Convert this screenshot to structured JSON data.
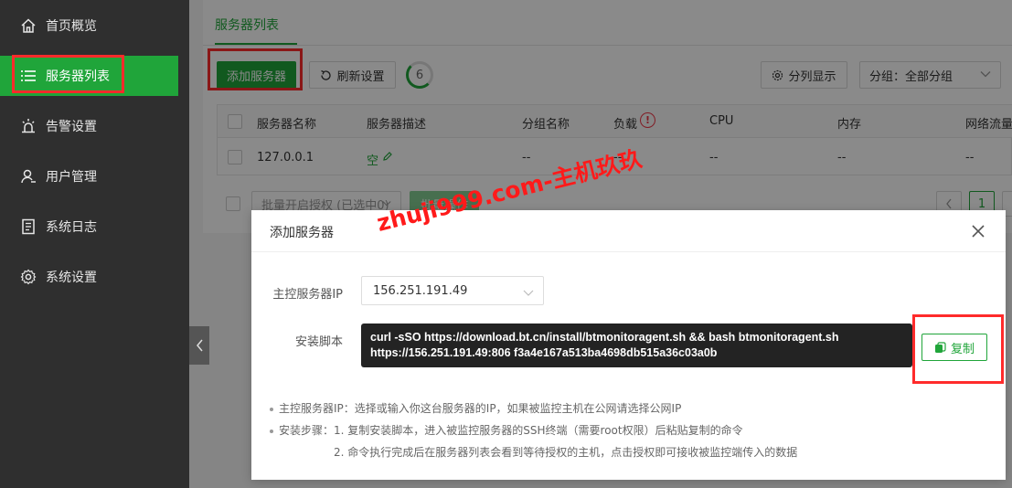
{
  "sidebar": {
    "items": [
      {
        "label": "首页概览",
        "icon": "home-icon"
      },
      {
        "label": "服务器列表",
        "icon": "list-icon"
      },
      {
        "label": "告警设置",
        "icon": "alarm-icon"
      },
      {
        "label": "用户管理",
        "icon": "user-icon"
      },
      {
        "label": "系统日志",
        "icon": "log-icon"
      },
      {
        "label": "系统设置",
        "icon": "gear-icon"
      }
    ]
  },
  "main": {
    "tab": "服务器列表",
    "toolbar": {
      "add_server": "添加服务器",
      "refresh_settings": "刷新设置",
      "refresh_count": "6",
      "column_display": "分列显示",
      "group_select": "分组：全部分组"
    },
    "table": {
      "headers": [
        "服务器名称",
        "服务器描述",
        "分组名称",
        "负载",
        "CPU",
        "内存",
        "网络流量"
      ],
      "rows": [
        {
          "name": "127.0.0.1",
          "desc": "空",
          "group": "--",
          "load": "--",
          "cpu": "--",
          "mem": "--",
          "net": "--"
        }
      ]
    },
    "batch": {
      "select": "批量开启授权 (已选中0)",
      "action": "批量操作"
    },
    "pagination": {
      "current": "1"
    }
  },
  "modal": {
    "title": "添加服务器",
    "ip_label": "主控服务器IP",
    "ip_value": "156.251.191.49",
    "script_label": "安装脚本",
    "script_line1": "curl -sSO https://download.bt.cn/install/btmonitoragent.sh && bash btmonitoragent.sh",
    "script_line2": "https://156.251.191.49:806 f3a4e167a513ba4698db515a36c03a0b",
    "copy": "复制",
    "notes": {
      "n1": "主控服务器IP：选择或输入你这台服务器的IP，如果被监控主机在公网请选择公网IP",
      "n2": "安装步骤：1. 复制安装脚本，进入被监控服务器的SSH终端（需要root权限）后粘贴复制的命令",
      "n3": "2. 命令执行完成后在服务器列表会看到等待授权的主机，点击授权即可接收被监控端传入的数据"
    }
  },
  "watermark": "zhuji999.com-主机玖玖",
  "colors": {
    "accent": "#20a53a",
    "highlight": "#ff2b2b",
    "sidebar": "#2f2f2f"
  }
}
